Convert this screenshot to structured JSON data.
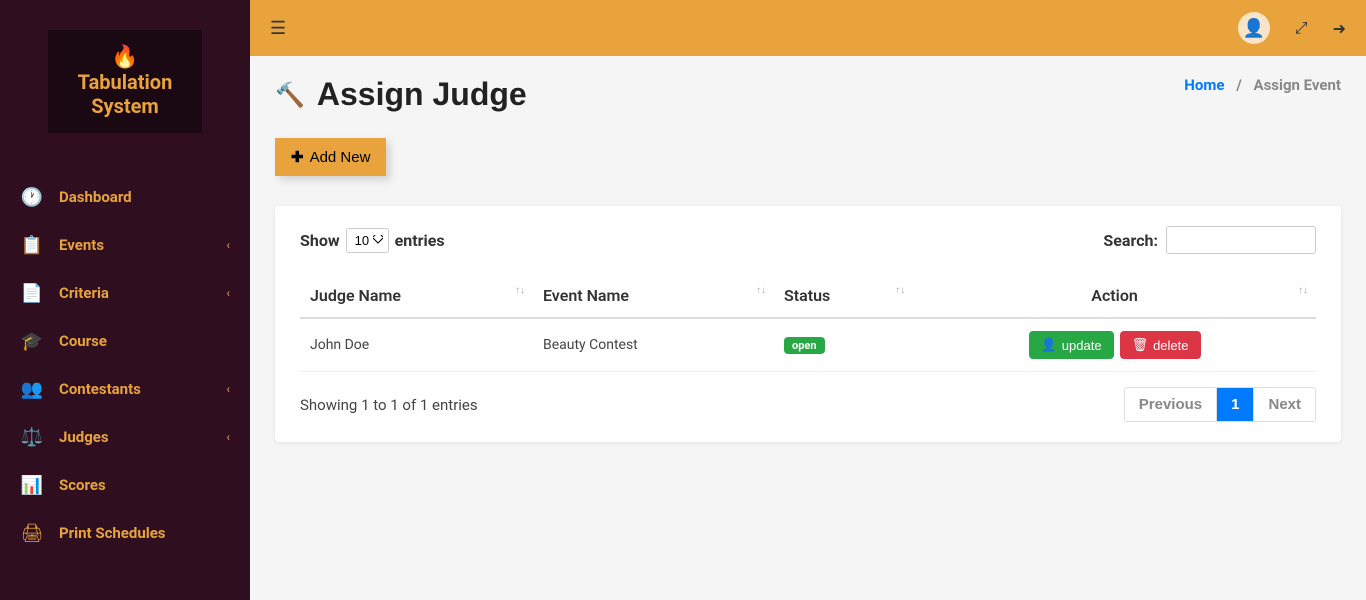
{
  "app": {
    "logo_line1": "Tabulation",
    "logo_line2": "System"
  },
  "sidebar": {
    "items": [
      {
        "icon": "🕐",
        "label": "Dashboard",
        "has_submenu": false
      },
      {
        "icon": "📋",
        "label": "Events",
        "has_submenu": true
      },
      {
        "icon": "📄",
        "label": "Criteria",
        "has_submenu": true
      },
      {
        "icon": "🎓",
        "label": "Course",
        "has_submenu": false
      },
      {
        "icon": "👥",
        "label": "Contestants",
        "has_submenu": true
      },
      {
        "icon": "⚖️",
        "label": "Judges",
        "has_submenu": true
      },
      {
        "icon": "📊",
        "label": "Scores",
        "has_submenu": false
      },
      {
        "icon": "🖨",
        "label": "Print Schedules",
        "has_submenu": false
      }
    ]
  },
  "page": {
    "title": "Assign Judge",
    "add_button": "Add New"
  },
  "breadcrumb": {
    "home": "Home",
    "current": "Assign Event"
  },
  "table": {
    "show_label": "Show",
    "entries_label": "entries",
    "entries_value": "10",
    "search_label": "Search:",
    "columns": {
      "judge": "Judge Name",
      "event": "Event Name",
      "status": "Status",
      "action": "Action"
    },
    "rows": [
      {
        "judge": "John Doe",
        "event": "Beauty Contest",
        "status": "open"
      }
    ],
    "action_labels": {
      "update": "update",
      "delete": "delete"
    },
    "showing_text": "Showing 1 to 1 of 1 entries",
    "pagination": {
      "previous": "Previous",
      "current": "1",
      "next": "Next"
    }
  }
}
